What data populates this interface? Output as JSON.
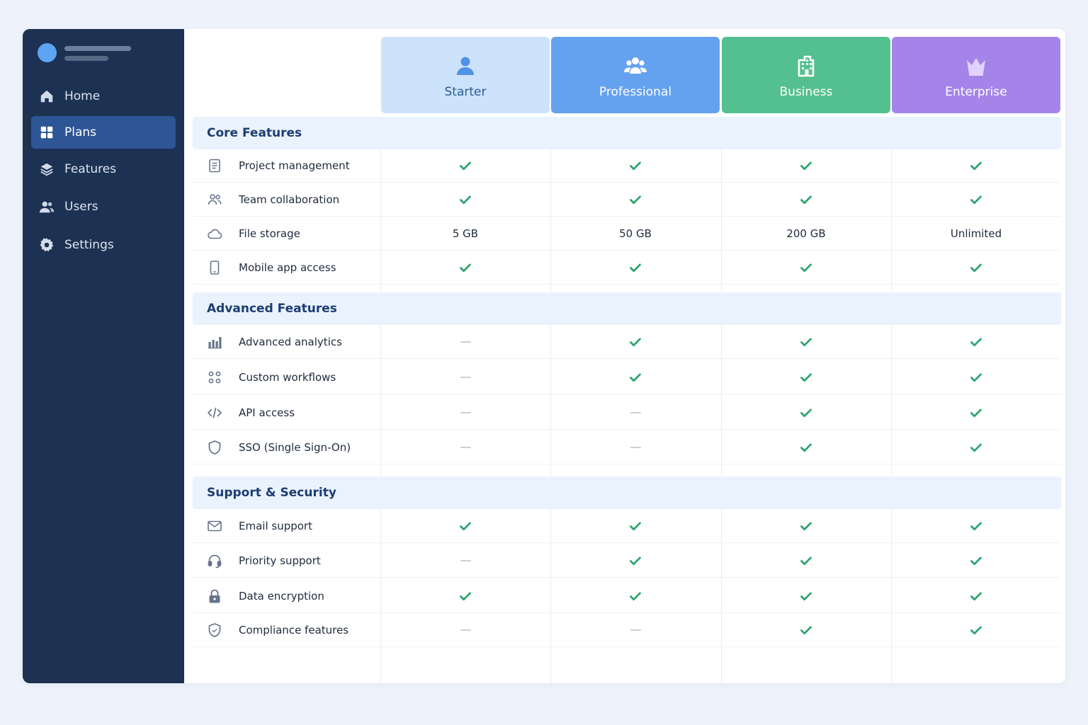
{
  "sidebar": {
    "items": [
      {
        "label": "Home",
        "icon": "home-icon",
        "active": false
      },
      {
        "label": "Plans",
        "icon": "grid-icon",
        "active": true
      },
      {
        "label": "Features",
        "icon": "layers-icon",
        "active": false
      },
      {
        "label": "Users",
        "icon": "users-icon",
        "active": false
      },
      {
        "label": "Settings",
        "icon": "gear-icon",
        "active": false
      }
    ]
  },
  "plans": [
    {
      "name": "Starter",
      "icon": "user-icon",
      "color": "#cde3fb",
      "text_color": "#2a5a96"
    },
    {
      "name": "Professional",
      "icon": "team-icon",
      "color": "#64a2ef",
      "text_color": "#ffffff"
    },
    {
      "name": "Business",
      "icon": "building-icon",
      "color": "#55c08f",
      "text_color": "#ffffff"
    },
    {
      "name": "Enterprise",
      "icon": "crown-icon",
      "color": "#a584ea",
      "text_color": "#ffffff"
    }
  ],
  "colors": {
    "check": "#2ea46e",
    "dash": "#c9d0da",
    "section_bg": "#eaf3fd",
    "sidebar_bg": "#1d3152"
  },
  "sections": [
    {
      "title": "Core Features",
      "rows": [
        {
          "label": "Project management",
          "icon": "document-icon",
          "values": [
            "check",
            "check",
            "check",
            "check"
          ]
        },
        {
          "label": "Team collaboration",
          "icon": "people-icon",
          "values": [
            "check",
            "check",
            "check",
            "check"
          ]
        },
        {
          "label": "File storage",
          "icon": "cloud-icon",
          "values": [
            "5 GB",
            "50 GB",
            "200 GB",
            "Unlimited"
          ]
        },
        {
          "label": "Mobile app access",
          "icon": "phone-icon",
          "values": [
            "check",
            "check",
            "check",
            "check"
          ]
        }
      ]
    },
    {
      "title": "Advanced Features",
      "rows": [
        {
          "label": "Advanced analytics",
          "icon": "bar-chart-icon",
          "values": [
            "dash",
            "check",
            "check",
            "check"
          ]
        },
        {
          "label": "Custom workflows",
          "icon": "workflow-icon",
          "values": [
            "dash",
            "check",
            "check",
            "check"
          ]
        },
        {
          "label": "API access",
          "icon": "code-icon",
          "values": [
            "dash",
            "dash",
            "check",
            "check"
          ]
        },
        {
          "label": "SSO (Single Sign-On)",
          "icon": "shield-icon",
          "values": [
            "dash",
            "dash",
            "check",
            "check"
          ]
        }
      ]
    },
    {
      "title": "Support & Security",
      "rows": [
        {
          "label": "Email support",
          "icon": "mail-icon",
          "values": [
            "check",
            "check",
            "check",
            "check"
          ]
        },
        {
          "label": "Priority support",
          "icon": "headset-icon",
          "values": [
            "dash",
            "check",
            "check",
            "check"
          ]
        },
        {
          "label": "Data encryption",
          "icon": "lock-icon",
          "values": [
            "check",
            "check",
            "check",
            "check"
          ]
        },
        {
          "label": "Compliance features",
          "icon": "shield-check-icon",
          "values": [
            "dash",
            "dash",
            "check",
            "check"
          ]
        }
      ]
    }
  ]
}
